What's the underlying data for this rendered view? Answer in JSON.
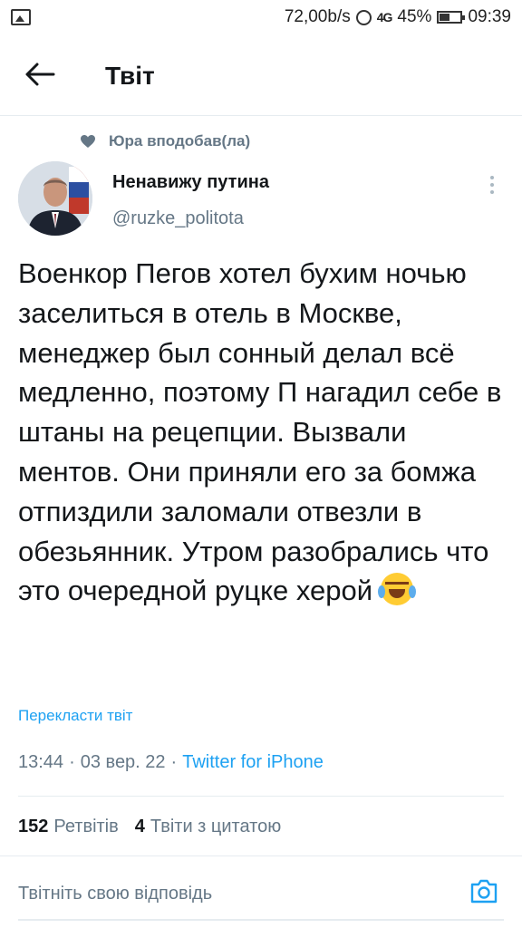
{
  "status_bar": {
    "speed": "72,00b/s",
    "signal": "4G",
    "battery": "45%",
    "time": "09:39"
  },
  "header": {
    "title": "Твіт"
  },
  "social_context": {
    "text": "Юра вподобав(ла)"
  },
  "author": {
    "name": "Ненавижу путина",
    "handle": "@ruzke_politota"
  },
  "tweet": {
    "text": "Военкор Пегов хотел бухим ночью заселиться в отель в Москве, менеджер был сонный делал всё медленно, поэтому П нагадил себе в штаны на рецепции. Вызвали ментов. Они приняли его за бомжа отпиздили заломали отвезли в обезьянник. Утром разобрались что это очередной руцке херой",
    "emoji": "face-with-tears-of-joy",
    "translate_label": "Перекласти твіт"
  },
  "meta": {
    "time": "13:44",
    "separator": "·",
    "date": "03 вер. 22",
    "source": "Twitter for iPhone"
  },
  "stats": {
    "retweets_count": "152",
    "retweets_label": "Ретвітів",
    "quotes_count": "4",
    "quotes_label": "Твіти з цитатою"
  },
  "reply": {
    "placeholder": "Твітніть свою відповідь"
  },
  "colors": {
    "accent": "#1da1f2",
    "secondary_text": "#657786",
    "divider": "#e6ecf0"
  },
  "icons": [
    "image-icon",
    "alarm-icon",
    "battery-icon",
    "back-arrow-icon",
    "heart-icon",
    "more-vertical-icon",
    "camera-icon"
  ]
}
